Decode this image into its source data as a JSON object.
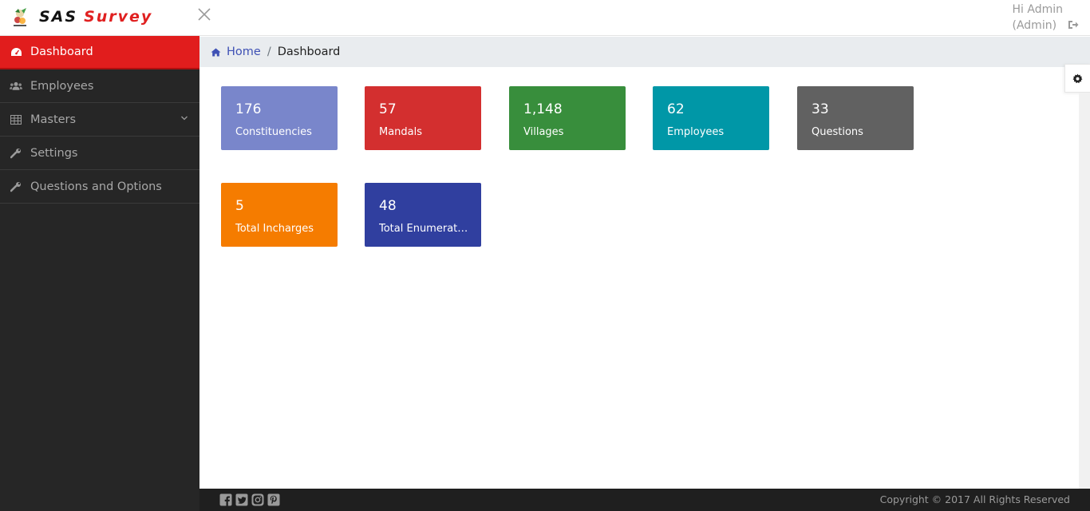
{
  "header": {
    "brand_part1": "SAS",
    "brand_part2": "Survey",
    "brand_color_primary": "#111111",
    "brand_color_accent": "#e02020",
    "greeting": "Hi Admin",
    "role": "(Admin)"
  },
  "sidebar": {
    "items": [
      {
        "label": "Dashboard",
        "icon": "dashboard-icon",
        "active": true
      },
      {
        "label": "Employees",
        "icon": "users-icon"
      },
      {
        "label": "Masters",
        "icon": "table-icon",
        "has_submenu": true
      },
      {
        "label": "Settings",
        "icon": "wrench-icon"
      },
      {
        "label": "Questions and Options",
        "icon": "wrench-icon"
      }
    ]
  },
  "breadcrumb": {
    "home": "Home",
    "separator": "/",
    "current": "Dashboard"
  },
  "cards": [
    {
      "value": "176",
      "label": "Constituencies",
      "color": "#7986cb"
    },
    {
      "value": "57",
      "label": "Mandals",
      "color": "#d32f2f"
    },
    {
      "value": "1,148",
      "label": "Villages",
      "color": "#388e3c"
    },
    {
      "value": "62",
      "label": "Employees",
      "color": "#0097a7"
    },
    {
      "value": "33",
      "label": "Questions",
      "color": "#616161"
    },
    {
      "value": "5",
      "label": "Total Incharges",
      "color": "#f57c00"
    },
    {
      "value": "48",
      "label": "Total Enumerators",
      "color": "#303f9f"
    }
  ],
  "footer": {
    "copyright": "Copyright © 2017 All Rights Reserved",
    "socials": [
      "facebook-icon",
      "twitter-icon",
      "instagram-icon",
      "pinterest-icon"
    ]
  }
}
